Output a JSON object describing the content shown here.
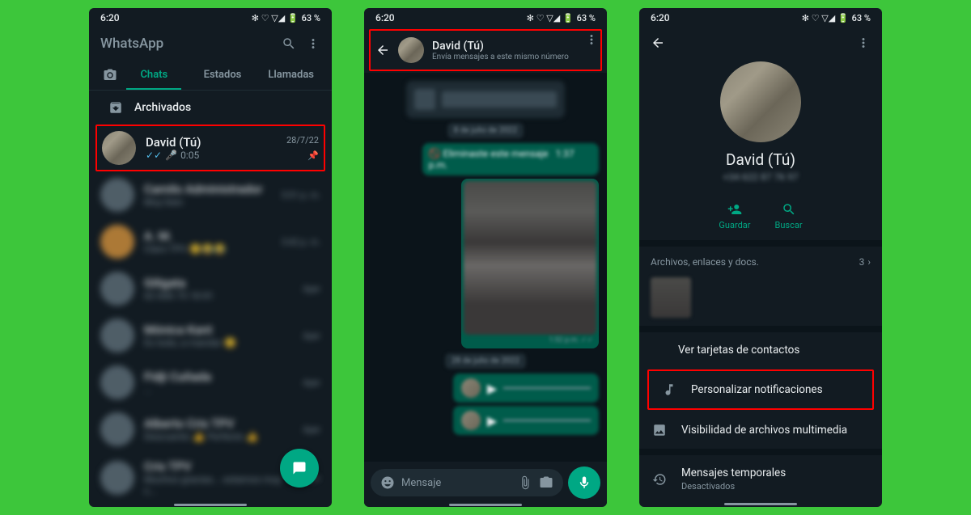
{
  "statusbar": {
    "time": "6:20",
    "battery": "63 %",
    "icons": "✻ ♡ ▽◢ 🔋"
  },
  "screen1": {
    "appTitle": "WhatsApp",
    "tabs": {
      "chats": "Chats",
      "estados": "Estados",
      "llamadas": "Llamadas"
    },
    "archived": "Archivados",
    "highlightedChat": {
      "name": "David (Tú)",
      "time": "28/7/22",
      "voiceLen": "0:05"
    },
    "blurryChats": [
      {
        "name": "Camilo Administrador",
        "preview": "Muy bien",
        "time": "5:51 p. m."
      },
      {
        "name": "A. M.",
        "preview": "Claro TPV 😊😂😂",
        "time": "3:42 p. m."
      },
      {
        "name": "Giligata",
        "preview": "02 606 75 18 81",
        "time": "Ayer"
      },
      {
        "name": "Mónica Kant",
        "preview": "Es todo, a mandar 😊",
        "time": "Ayer"
      },
      {
        "name": "Fidji Cuñada",
        "preview": "...",
        "time": "Ayer"
      },
      {
        "name": "Alberto Cris TPV",
        "preview": "Descuento 👍 Perfecto 👍",
        "time": "Ayer"
      },
      {
        "name": "Cris TPV",
        "preview": "Muchos gracias... estamos muy c...",
        "time": "Ayer"
      }
    ]
  },
  "screen2": {
    "headerName": "David (Tú)",
    "headerSub": "Envía mensajes a este mismo número",
    "inputPlaceholder": "Mensaje"
  },
  "screen3": {
    "name": "David (Tú)",
    "phone": "+34 622 87 76 97",
    "actions": {
      "guardar": "Guardar",
      "buscar": "Buscar"
    },
    "mediaLabel": "Archivos, enlaces y docs.",
    "mediaCount": "3",
    "contactCards": "Ver tarjetas de contactos",
    "customNotif": "Personalizar notificaciones",
    "mediaVis": "Visibilidad de archivos multimedia",
    "tempMsg": "Mensajes temporales",
    "tempMsgSub": "Desactivados"
  }
}
